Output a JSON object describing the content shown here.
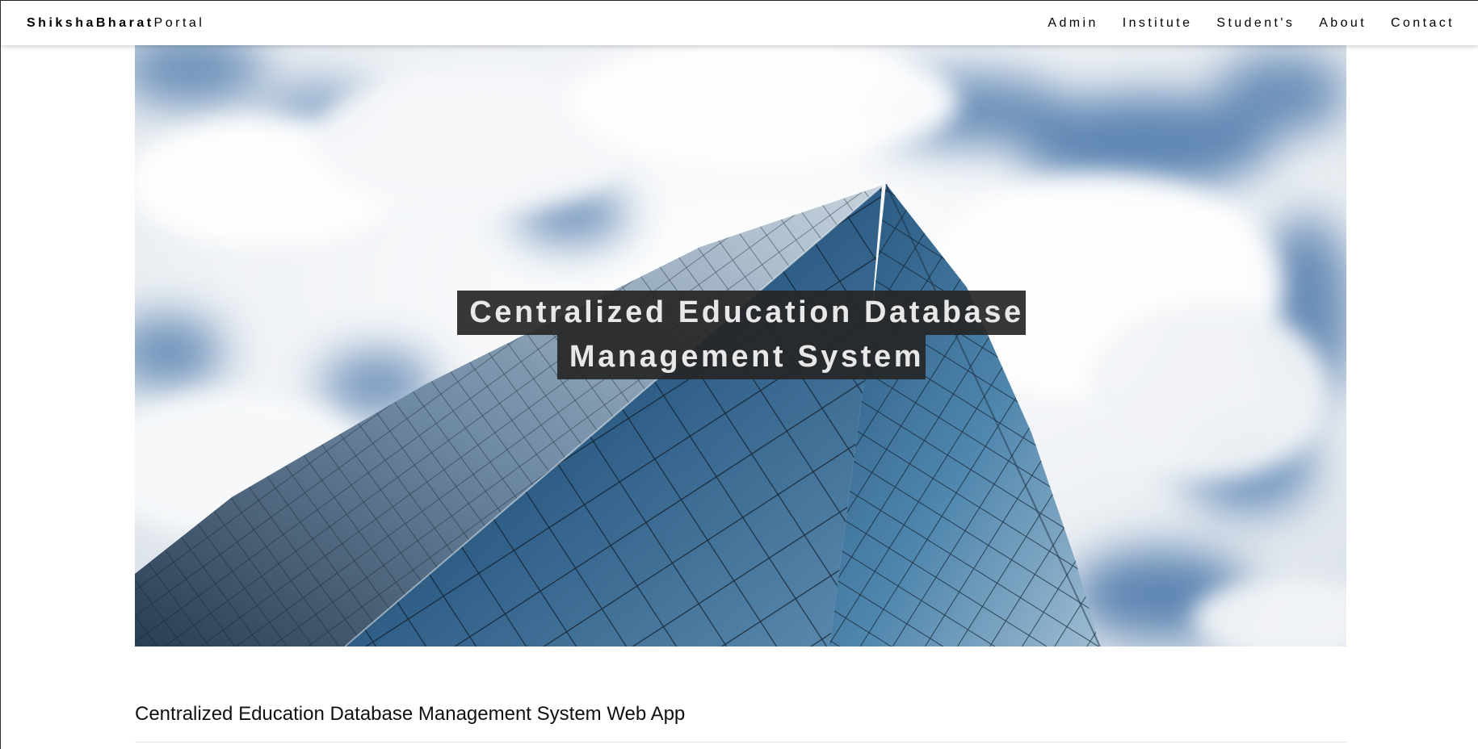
{
  "header": {
    "brand_bold": "ShikshaBharat",
    "brand_light": "Portal",
    "nav": [
      {
        "label": "Admin"
      },
      {
        "label": "Institute"
      },
      {
        "label": "Student's"
      },
      {
        "label": "About"
      },
      {
        "label": "Contact"
      }
    ]
  },
  "hero": {
    "title_line1": "Centralized Education Database",
    "title_line2": "Management System",
    "image": "glass-skyscraper-against-cloudy-sky"
  },
  "main": {
    "section_title": "Centralized Education Database Management System Web App"
  },
  "colors": {
    "sky": "#5f86b3",
    "cloud": "#f1f3f6",
    "glass_dark": "#1c3a55",
    "title_bg": "#262626",
    "title_text": "#e8e8e8"
  }
}
